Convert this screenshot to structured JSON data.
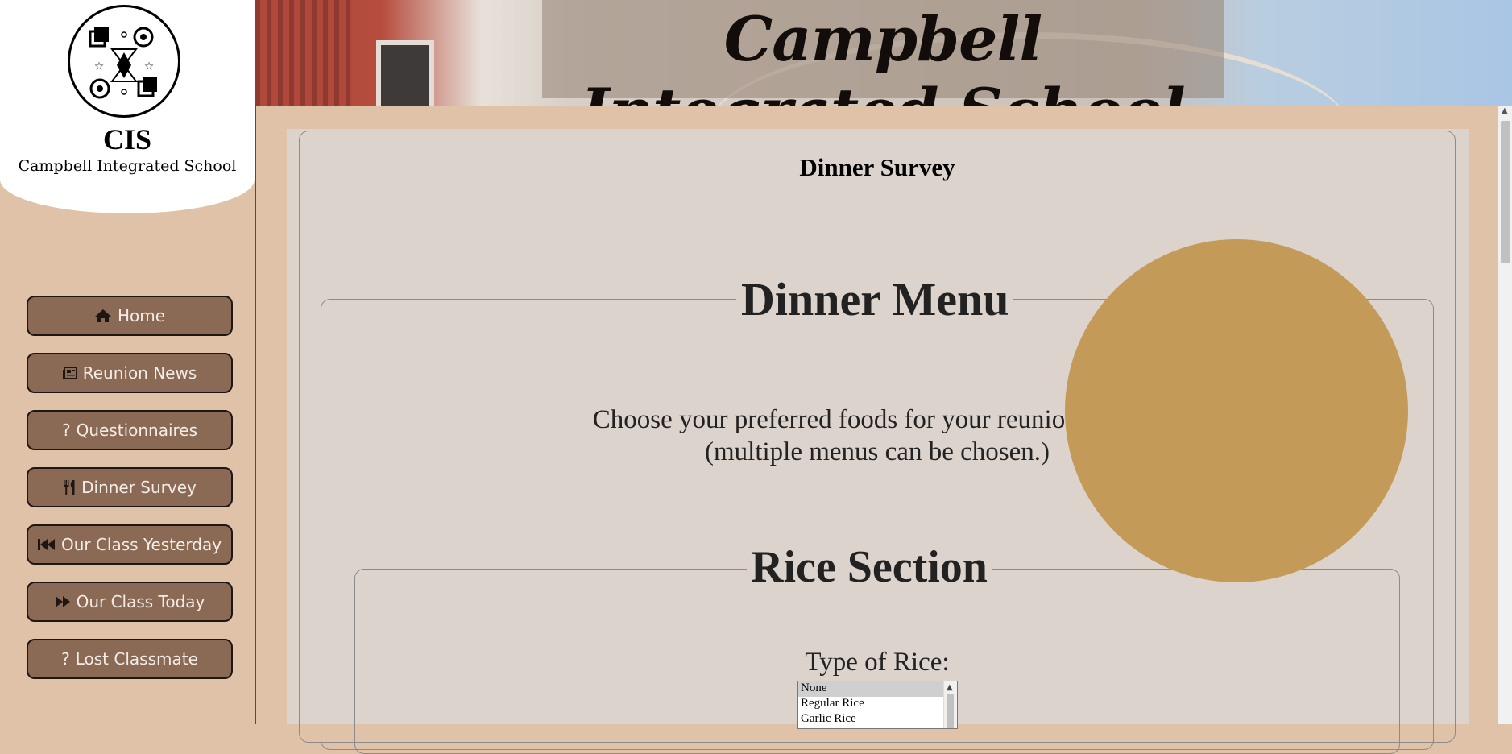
{
  "school": {
    "acronym": "CIS",
    "name": "Campbell Integrated School"
  },
  "header": {
    "title": "Campbell Integrated School"
  },
  "nav": [
    {
      "label": "Home",
      "icon": "home-icon"
    },
    {
      "label": "Reunion News",
      "icon": "newspaper-icon"
    },
    {
      "label": "Questionnaires",
      "icon": "question-icon"
    },
    {
      "label": "Dinner Survey",
      "icon": "utensils-icon"
    },
    {
      "label": "Our Class Yesterday",
      "icon": "backward-icon"
    },
    {
      "label": "Our Class Today",
      "icon": "forward-icon"
    },
    {
      "label": "Lost Classmate",
      "icon": "question-icon"
    }
  ],
  "survey": {
    "title": "Dinner Survey",
    "menu_legend": "Dinner Menu",
    "intro_line1": "Choose your preferred foods for your reunion dinner!",
    "intro_line2": "(multiple menus can be chosen.)",
    "rice_legend": "Rice Section",
    "rice_label": "Type of Rice:",
    "rice_options": [
      "None",
      "Regular Rice",
      "Garlic Rice"
    ],
    "rice_selected": "None"
  },
  "colors": {
    "sidebar_bg": "#dfc2a8",
    "button_bg": "#8a6a55",
    "panel_bg": "#dcd3cd",
    "accent_circle": "#c49a58"
  }
}
